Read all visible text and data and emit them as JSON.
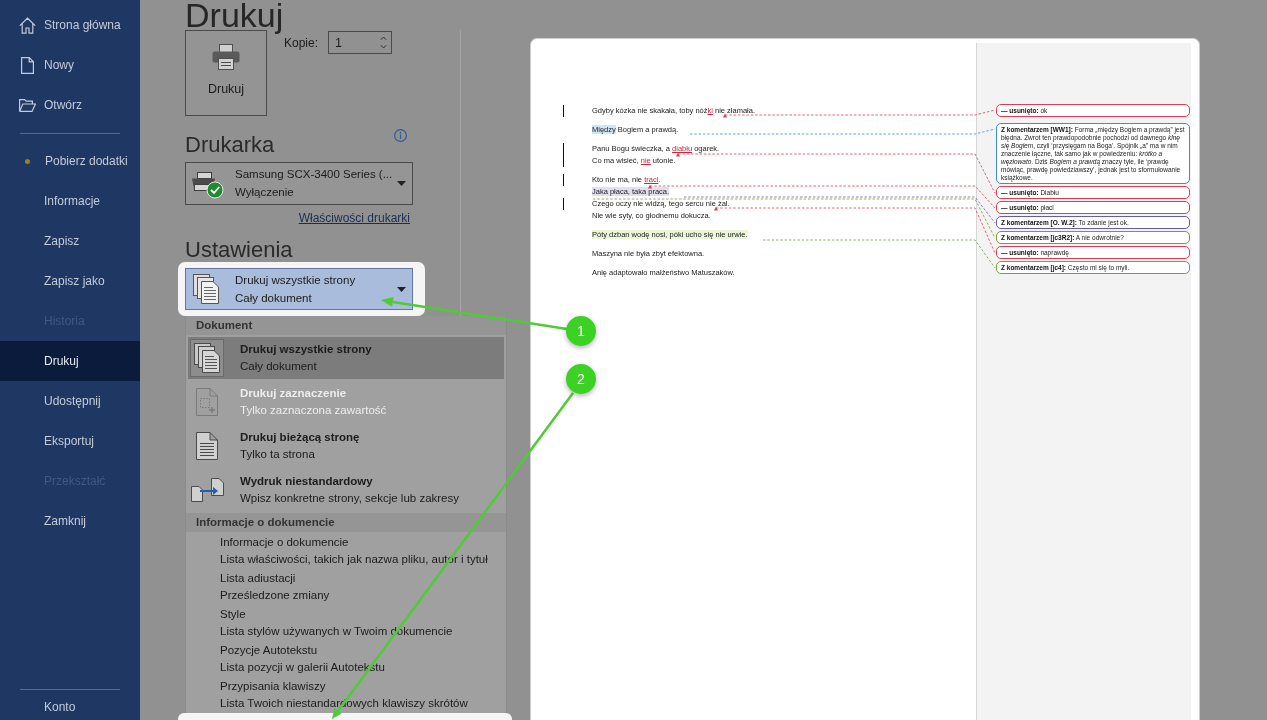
{
  "sidebar": {
    "top_items": [
      {
        "label": "Strona główna",
        "selected": false
      },
      {
        "label": "Nowy",
        "selected": false
      },
      {
        "label": "Otwórz",
        "selected": false
      }
    ],
    "items": [
      {
        "label": "Pobierz dodatki",
        "selected": false,
        "disabled": false,
        "dot": true
      },
      {
        "label": "Informacje",
        "selected": false,
        "disabled": false,
        "dot": false
      },
      {
        "label": "Zapisz",
        "selected": false,
        "disabled": false,
        "dot": false
      },
      {
        "label": "Zapisz jako",
        "selected": false,
        "disabled": false,
        "dot": false
      },
      {
        "label": "Historia",
        "selected": false,
        "disabled": true,
        "dot": false
      },
      {
        "label": "Drukuj",
        "selected": true,
        "disabled": false,
        "dot": false
      },
      {
        "label": "Udostępnij",
        "selected": false,
        "disabled": false,
        "dot": false
      },
      {
        "label": "Eksportuj",
        "selected": false,
        "disabled": false,
        "dot": false
      },
      {
        "label": "Przekształć",
        "selected": false,
        "disabled": true,
        "dot": false
      },
      {
        "label": "Zamknij",
        "selected": false,
        "disabled": false,
        "dot": false
      }
    ],
    "bottom_items": [
      {
        "label": "Konto",
        "selected": false
      }
    ]
  },
  "print": {
    "title": "Drukuj",
    "print_button": "Drukuj",
    "copies": {
      "label": "Kopie:",
      "value": "1"
    }
  },
  "printer": {
    "heading": "Drukarka",
    "name": "Samsung SCX-3400 Series (...",
    "status": "Wyłączenie",
    "properties_link": "Właściwości drukarki"
  },
  "settings": {
    "heading": "Ustawienia",
    "dropdown": {
      "title": "Drukuj wszystkie strony",
      "subtitle": "Cały dokument",
      "expanded": true
    },
    "menu": [
      {
        "header": "Dokument",
        "items": [
          {
            "kind": "option",
            "title": "Drukuj wszystkie strony",
            "subtitle": "Cały dokument",
            "selected": true,
            "disabled": false
          },
          {
            "kind": "option",
            "title": "Drukuj zaznaczenie",
            "subtitle": "Tylko zaznaczona zawartość",
            "selected": false,
            "disabled": true
          },
          {
            "kind": "option",
            "title": "Drukuj bieżącą stronę",
            "subtitle": "Tylko ta strona",
            "selected": false,
            "disabled": false
          },
          {
            "kind": "option",
            "title": "Wydruk niestandardowy",
            "subtitle": "Wpisz konkretne strony, sekcje lub zakresy",
            "selected": false,
            "disabled": false
          }
        ]
      },
      {
        "header": "Informacje o dokumencie",
        "items": [
          {
            "kind": "info",
            "title": "Informacje o dokumencie",
            "subtitle": "Lista właściwości, takich jak nazwa pliku, autor i tytuł",
            "selected": false,
            "disabled": false
          },
          {
            "kind": "info",
            "title": "Lista adiustacji",
            "subtitle": "Prześledzone zmiany",
            "selected": false,
            "disabled": false
          },
          {
            "kind": "info",
            "title": "Style",
            "subtitle": "Lista stylów używanych w Twoim dokumencie",
            "selected": false,
            "disabled": false
          },
          {
            "kind": "info",
            "title": "Pozycje Autotekstu",
            "subtitle": "Lista pozycji w galerii Autotekstu",
            "selected": false,
            "disabled": false
          },
          {
            "kind": "info",
            "title": "Przypisania klawiszy",
            "subtitle": "Lista Twoich niestandardowych klawiszy skrótów",
            "selected": false,
            "disabled": false
          }
        ]
      }
    ]
  },
  "preview": {
    "paragraphs": [
      {
        "lines": [
          {
            "change_bar": true,
            "segments": [
              {
                "kind": "text",
                "text": "Gdyby kózka nie skakała, toby nóż"
              },
              {
                "kind": "insert",
                "text": "ki"
              },
              {
                "kind": "text",
                "text": " nie złamała."
              }
            ]
          }
        ]
      },
      {
        "lines": [
          {
            "change_bar": false,
            "segments": [
              {
                "kind": "range",
                "text": "Między",
                "color": "#cfe6f7"
              },
              {
                "kind": "text",
                "text": " Bogiem a prawdą."
              }
            ]
          }
        ]
      },
      {
        "lines": [
          {
            "change_bar": true,
            "segments": [
              {
                "kind": "text",
                "text": "Panu Bogu świeczka, a "
              },
              {
                "kind": "insert",
                "text": "diabłu"
              },
              {
                "kind": "text",
                "text": " ogarek."
              }
            ]
          },
          {
            "change_bar": true,
            "segments": [
              {
                "kind": "text",
                "text": "Co ma wisieć, "
              },
              {
                "kind": "insert",
                "text": "nie"
              },
              {
                "kind": "text",
                "text": " utonie."
              }
            ]
          }
        ]
      },
      {
        "lines": [
          {
            "change_bar": true,
            "segments": [
              {
                "kind": "text",
                "text": "Kto nie ma, nie "
              },
              {
                "kind": "insert",
                "text": "traci"
              },
              {
                "kind": "text",
                "text": "."
              }
            ]
          },
          {
            "change_bar": false,
            "segments": [
              {
                "kind": "range",
                "text": "Jaka płaca, taka praca.",
                "color": "#e3e0ee"
              }
            ]
          },
          {
            "change_bar": true,
            "segments": [
              {
                "kind": "text",
                "text": "Czego oczy nie widzą, tego sercu nie żal."
              }
            ]
          },
          {
            "change_bar": false,
            "segments": [
              {
                "kind": "text",
                "text": "Nie wie syty, co głodnemu dokucza."
              }
            ]
          }
        ]
      },
      {
        "lines": [
          {
            "change_bar": false,
            "segments": [
              {
                "kind": "range",
                "text": "Póty dzban wodę nosi, póki ucho się nie urwie.",
                "color": "#ebf5d8"
              }
            ]
          }
        ]
      },
      {
        "lines": [
          {
            "change_bar": false,
            "segments": [
              {
                "kind": "text",
                "text": "Maszyna nie była zbyt efektowna."
              }
            ]
          }
        ]
      },
      {
        "lines": [
          {
            "change_bar": false,
            "segments": [
              {
                "kind": "text",
                "text": "Anię adaptowało małżeństwo Matuszaków."
              }
            ]
          }
        ]
      }
    ],
    "comments": [
      {
        "kind": "deletion",
        "label": "— usunięto:",
        "text": "ok",
        "color": "#d8405a"
      },
      {
        "kind": "comment",
        "label": "Z komentarzem [WW1]:",
        "text": "Forma „między Bogiem a prawdą” jest błędna. Zwrot ten prawdopodobnie pochodzi od dawnego *klnę się Bogiem*, czyli ‘przysięgam na Boga’. Spójnik „a” ma w nim znaczenie łączne, tak samo jak w powiedzeniu: *krótko a węzłowato*. Dziś *Bogiem a prawdą* znaczy tyle, ile ‘prawdę mówiąc, prawdę powiedziawszy’, jednak jest to sformułowanie książkowe.",
        "color": "#3a8ed5"
      },
      {
        "kind": "deletion",
        "label": "— usunięto:",
        "text": "Diabłu",
        "color": "#d8405a"
      },
      {
        "kind": "deletion",
        "label": "— usunięto:",
        "text": "płaci",
        "color": "#d8405a"
      },
      {
        "kind": "comment",
        "label": "Z komentarzem [O. W.2]:",
        "text": "To zdanie jest ok.",
        "color": "#6a5aa8"
      },
      {
        "kind": "comment",
        "label": "Z komentarzem [jc3R2]:",
        "text": "A nie odwrotnie?",
        "color": "#7f963a"
      },
      {
        "kind": "deletion",
        "label": "— usunięto:",
        "text": "naprawdę",
        "color": "#d8405a"
      },
      {
        "kind": "comment",
        "label": "Z komentarzem [jc4]:",
        "text": "Często mi się to myli.",
        "color": "#66aa3a"
      }
    ]
  },
  "annotations": [
    {
      "number": "1"
    },
    {
      "number": "2"
    }
  ]
}
